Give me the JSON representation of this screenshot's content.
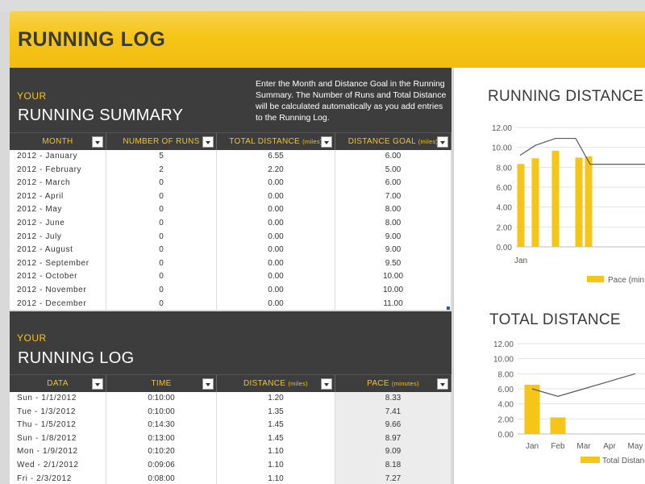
{
  "banner": {
    "title": "RUNNING LOG"
  },
  "summary": {
    "your": "YOUR",
    "title": "RUNNING SUMMARY",
    "instructions": "Enter the Month and Distance Goal in the Running Summary. The Number of Runs and Total Distance will be calculated automatically as you add entries to the Running Log.",
    "headers": {
      "month": "MONTH",
      "runs": "NUMBER OF RUNS",
      "distance": "TOTAL DISTANCE",
      "distance_unit": "(miles)",
      "goal": "DISTANCE GOAL",
      "goal_unit": "(miles)"
    },
    "rows": [
      {
        "month": "2012 - January",
        "runs": "5",
        "distance": "6.55",
        "goal": "6.00"
      },
      {
        "month": "2012 - February",
        "runs": "2",
        "distance": "2.20",
        "goal": "5.00"
      },
      {
        "month": "2012 - March",
        "runs": "0",
        "distance": "0.00",
        "goal": "6.00"
      },
      {
        "month": "2012 - April",
        "runs": "0",
        "distance": "0.00",
        "goal": "7.00"
      },
      {
        "month": "2012 - May",
        "runs": "0",
        "distance": "0.00",
        "goal": "8.00"
      },
      {
        "month": "2012 - June",
        "runs": "0",
        "distance": "0.00",
        "goal": "8.00"
      },
      {
        "month": "2012 - July",
        "runs": "0",
        "distance": "0.00",
        "goal": "9.00"
      },
      {
        "month": "2012 - August",
        "runs": "0",
        "distance": "0.00",
        "goal": "9.00"
      },
      {
        "month": "2012 - September",
        "runs": "0",
        "distance": "0.00",
        "goal": "9.50"
      },
      {
        "month": "2012 - October",
        "runs": "0",
        "distance": "0.00",
        "goal": "10.00"
      },
      {
        "month": "2012 - November",
        "runs": "0",
        "distance": "0.00",
        "goal": "10.00"
      },
      {
        "month": "2012 - December",
        "runs": "0",
        "distance": "0.00",
        "goal": "11.00"
      }
    ]
  },
  "log": {
    "your": "YOUR",
    "title": "RUNNING LOG",
    "headers": {
      "data": "DATA",
      "time": "TIME",
      "distance": "DISTANCE",
      "distance_unit": "(miles)",
      "pace": "PACE",
      "pace_unit": "(minutes)"
    },
    "rows": [
      {
        "date": "Sun  -  1/1/2012",
        "time": "0:10:00",
        "distance": "1.20",
        "pace": "8.33"
      },
      {
        "date": "Tue  -  1/3/2012",
        "time": "0:10:00",
        "distance": "1.35",
        "pace": "7.41"
      },
      {
        "date": "Thu  -  1/5/2012",
        "time": "0:14:30",
        "distance": "1.45",
        "pace": "9.66"
      },
      {
        "date": "Sun  -  1/8/2012",
        "time": "0:13:00",
        "distance": "1.45",
        "pace": "8.97"
      },
      {
        "date": "Mon  -  1/9/2012",
        "time": "0:10:20",
        "distance": "1.10",
        "pace": "9.09"
      },
      {
        "date": "Wed  -  2/1/2012",
        "time": "0:09:06",
        "distance": "1.10",
        "pace": "8.18"
      },
      {
        "date": "Fri  -  2/3/2012",
        "time": "0:08:00",
        "distance": "1.10",
        "pace": "7.27"
      }
    ]
  },
  "charts": {
    "distance_title": "RUNNING DISTANCE",
    "total_title": "TOTAL DISTANCE"
  },
  "chart_data": [
    {
      "type": "bar",
      "title": "RUNNING DISTANCE",
      "ylim": [
        0,
        12
      ],
      "yticks": [
        "0.00",
        "2.00",
        "4.00",
        "6.00",
        "8.00",
        "10.00",
        "12.00"
      ],
      "x_visible_label": "Jan",
      "series": [
        {
          "name": "Pace",
          "values": [
            8.33,
            8.9,
            9.66,
            8.97,
            9.09
          ]
        },
        {
          "name": "",
          "type": "line",
          "values": [
            9.2,
            10.2,
            10.9,
            10.9,
            8.3,
            8.3
          ]
        }
      ],
      "legend": "bottom"
    },
    {
      "type": "bar",
      "title": "TOTAL DISTANCE",
      "ylim": [
        0,
        12
      ],
      "yticks": [
        "0.00",
        "2.00",
        "4.00",
        "6.00",
        "8.00",
        "10.00",
        "12.00"
      ],
      "categories": [
        "Jan",
        "Feb",
        "Mar",
        "Apr",
        "May"
      ],
      "series": [
        {
          "name": "Total Distance",
          "values": [
            6.55,
            2.2,
            0,
            0,
            0
          ]
        },
        {
          "name": "",
          "type": "line",
          "values": [
            6.0,
            5.0,
            6.0,
            7.0,
            8.0
          ]
        }
      ],
      "legend": "bottom"
    }
  ],
  "colors": {
    "accent": "#f5c518",
    "panel": "#3d3d3d",
    "line": "#595959"
  }
}
